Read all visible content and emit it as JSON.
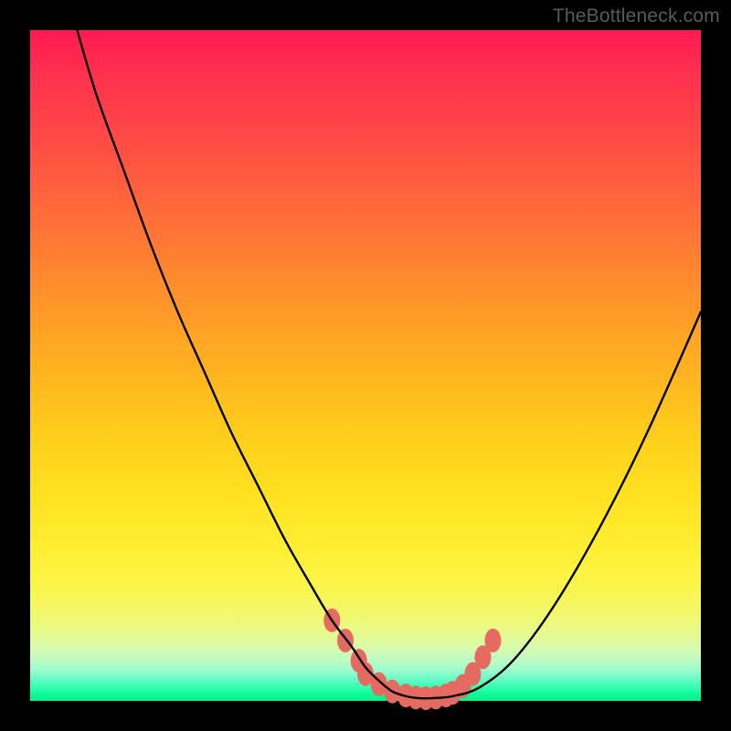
{
  "watermark": "TheBottleneck.com",
  "chart_data": {
    "type": "line",
    "title": "",
    "xlabel": "",
    "ylabel": "",
    "xlim": [
      0,
      100
    ],
    "ylim": [
      0,
      100
    ],
    "grid": false,
    "series": [
      {
        "name": "bottleneck-curve",
        "x": [
          7,
          10,
          14,
          18,
          22,
          26,
          30,
          34,
          38,
          42,
          45,
          48,
          50,
          52,
          54,
          56,
          58,
          60,
          63,
          67,
          72,
          78,
          85,
          92,
          100
        ],
        "values": [
          100,
          90,
          79,
          68,
          58,
          49,
          40,
          32,
          24,
          17,
          12,
          8,
          5,
          3,
          1.4,
          0.7,
          0.4,
          0.4,
          0.7,
          2,
          6,
          14,
          26,
          40,
          58
        ]
      }
    ],
    "markers": {
      "name": "bottom-blob-markers",
      "color": "#e56a62",
      "points": [
        {
          "x": 45,
          "y": 12
        },
        {
          "x": 47,
          "y": 9
        },
        {
          "x": 49,
          "y": 6
        },
        {
          "x": 50,
          "y": 4
        },
        {
          "x": 52,
          "y": 2.5
        },
        {
          "x": 54,
          "y": 1.4
        },
        {
          "x": 56,
          "y": 0.8
        },
        {
          "x": 57.5,
          "y": 0.5
        },
        {
          "x": 59,
          "y": 0.4
        },
        {
          "x": 60.5,
          "y": 0.5
        },
        {
          "x": 62,
          "y": 0.8
        },
        {
          "x": 63,
          "y": 1.2
        },
        {
          "x": 64.5,
          "y": 2.2
        },
        {
          "x": 66,
          "y": 4
        },
        {
          "x": 67.5,
          "y": 6.5
        },
        {
          "x": 69,
          "y": 9
        }
      ]
    }
  }
}
